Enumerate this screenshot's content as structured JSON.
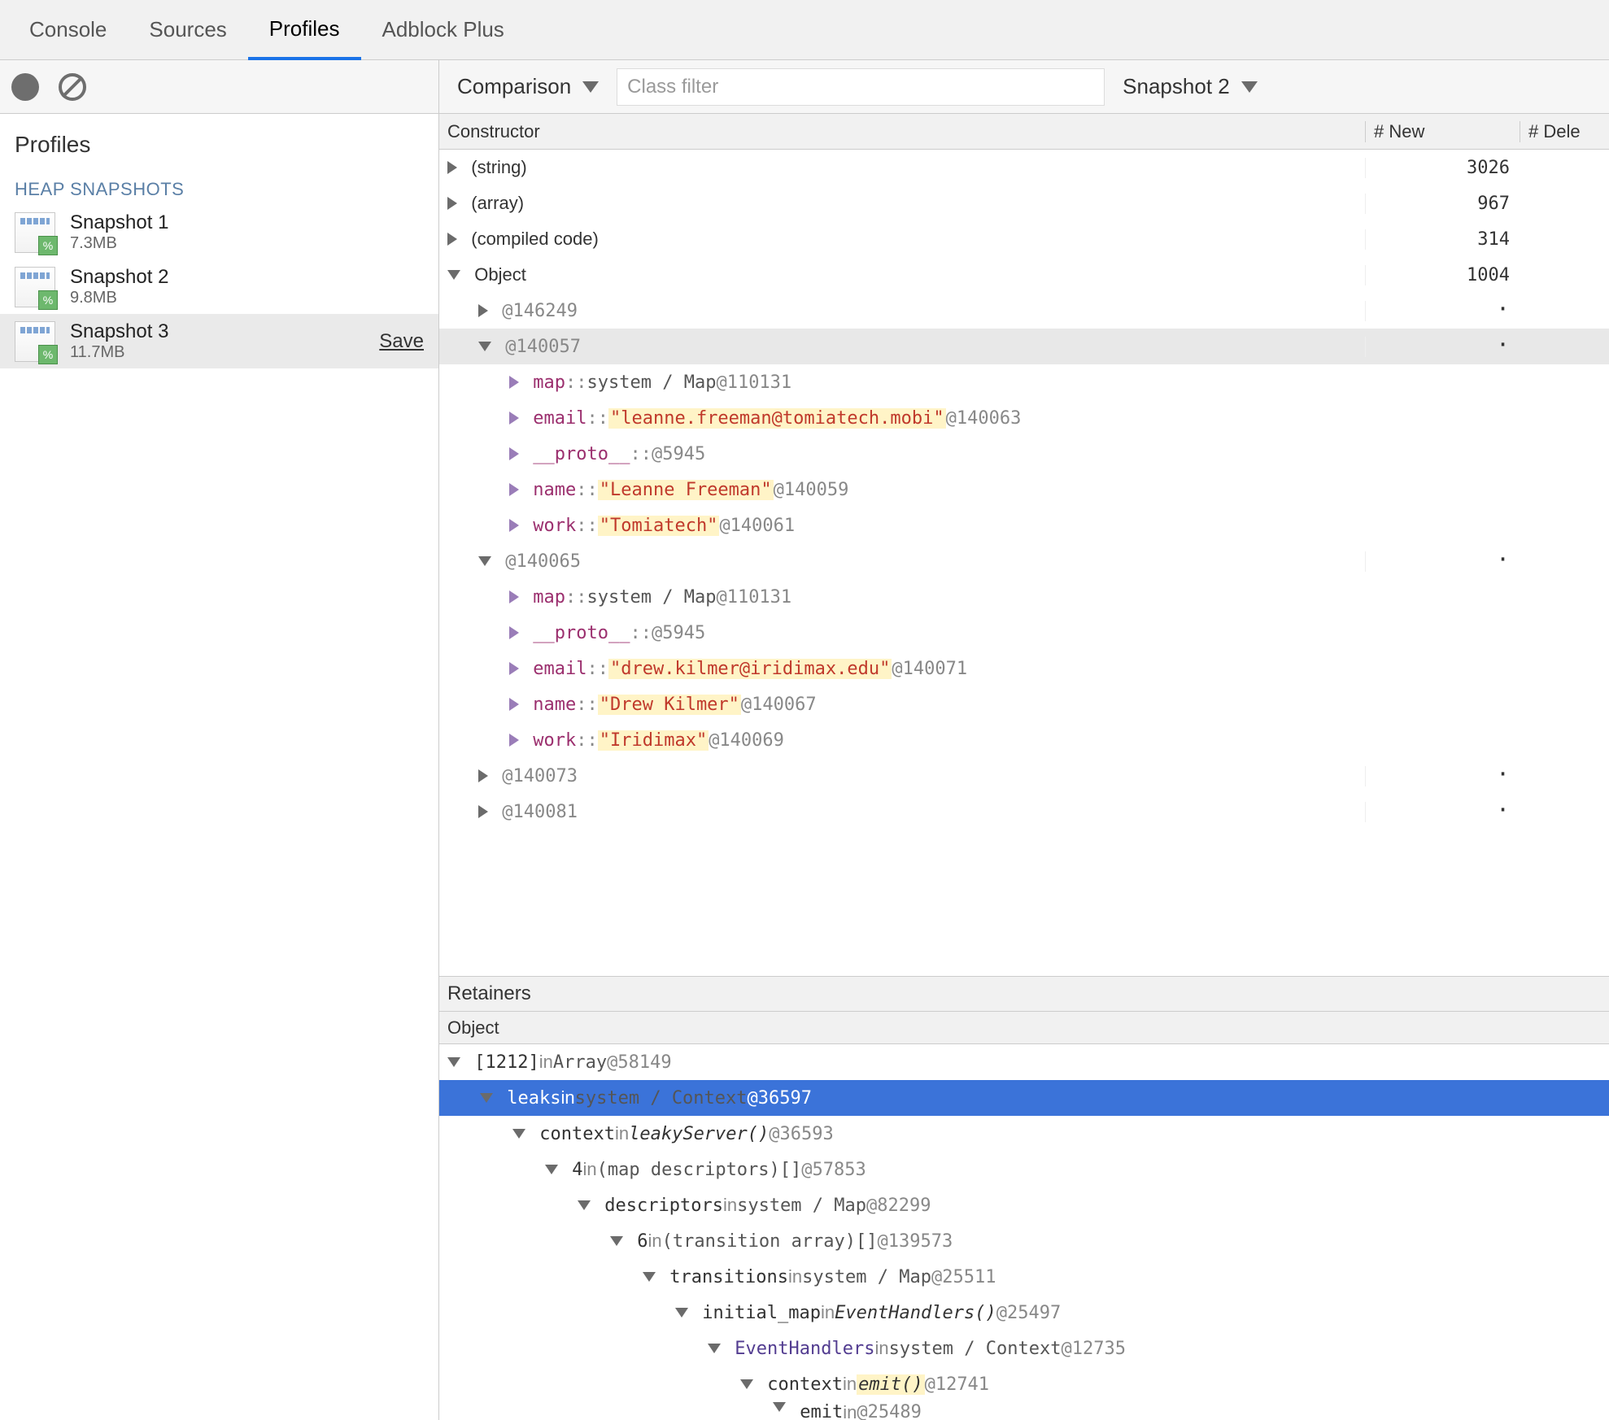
{
  "tabs": [
    "Console",
    "Sources",
    "Profiles",
    "Adblock Plus"
  ],
  "activeTab": "Profiles",
  "sidebar": {
    "title": "Profiles",
    "heading": "HEAP SNAPSHOTS",
    "snapshots": [
      {
        "name": "Snapshot 1",
        "size": "7.3MB"
      },
      {
        "name": "Snapshot 2",
        "size": "9.8MB"
      },
      {
        "name": "Snapshot 3",
        "size": "11.7MB",
        "selected": true,
        "save": "Save"
      }
    ]
  },
  "toolbar": {
    "view": "Comparison",
    "filterPlaceholder": "Class filter",
    "compareTo": "Snapshot 2"
  },
  "columns": {
    "constructor": "Constructor",
    "new": "# New",
    "dele": "# Dele"
  },
  "rows": [
    {
      "indent": 0,
      "arrow": "right",
      "label": "(string)",
      "new": "3026"
    },
    {
      "indent": 0,
      "arrow": "right",
      "label": "(array)",
      "new": "967"
    },
    {
      "indent": 0,
      "arrow": "right",
      "label": "(compiled code)",
      "new": "314"
    },
    {
      "indent": 0,
      "arrow": "down",
      "label": "Object",
      "new": "1004"
    },
    {
      "indent": 1,
      "arrow": "right",
      "addr": "@146249",
      "new": "·"
    },
    {
      "indent": 1,
      "arrow": "down",
      "addr": "@140057",
      "new": "·",
      "hl": true
    },
    {
      "indent": 2,
      "arrow": "right",
      "purple": true,
      "prop": "map",
      "sep": "::",
      "sys": "system / Map",
      "addr": "@110131"
    },
    {
      "indent": 2,
      "arrow": "right",
      "purple": true,
      "prop": "email",
      "sep": "::",
      "str": "\"leanne.freeman@tomiatech.mobi\"",
      "addr": "@140063"
    },
    {
      "indent": 2,
      "arrow": "right",
      "purple": true,
      "prop": "__proto__",
      "sep": "::",
      "addr": "@5945"
    },
    {
      "indent": 2,
      "arrow": "right",
      "purple": true,
      "prop": "name",
      "sep": "::",
      "str": "\"Leanne Freeman\"",
      "addr": "@140059"
    },
    {
      "indent": 2,
      "arrow": "right",
      "purple": true,
      "prop": "work",
      "sep": "::",
      "str": "\"Tomiatech\"",
      "addr": "@140061"
    },
    {
      "indent": 1,
      "arrow": "down",
      "addr": "@140065",
      "new": "·"
    },
    {
      "indent": 2,
      "arrow": "right",
      "purple": true,
      "prop": "map",
      "sep": "::",
      "sys": "system / Map",
      "addr": "@110131"
    },
    {
      "indent": 2,
      "arrow": "right",
      "purple": true,
      "prop": "__proto__",
      "sep": "::",
      "addr": "@5945"
    },
    {
      "indent": 2,
      "arrow": "right",
      "purple": true,
      "prop": "email",
      "sep": "::",
      "str": "\"drew.kilmer@iridimax.edu\"",
      "addr": "@140071"
    },
    {
      "indent": 2,
      "arrow": "right",
      "purple": true,
      "prop": "name",
      "sep": "::",
      "str": "\"Drew Kilmer\"",
      "addr": "@140067"
    },
    {
      "indent": 2,
      "arrow": "right",
      "purple": true,
      "prop": "work",
      "sep": "::",
      "str": "\"Iridimax\"",
      "addr": "@140069"
    },
    {
      "indent": 1,
      "arrow": "right",
      "addr": "@140073",
      "new": "·"
    },
    {
      "indent": 1,
      "arrow": "right",
      "addr": "@140081",
      "new": "·"
    }
  ],
  "retainers": {
    "title": "Retainers",
    "objectTitle": "Object",
    "rows": [
      {
        "indent": 0,
        "arrow": "down",
        "seg": [
          {
            "t": "plain",
            "v": "[1212] "
          },
          {
            "t": "kw",
            "v": "in "
          },
          {
            "t": "ctx",
            "v": "Array "
          },
          {
            "t": "addr",
            "v": "@58149"
          }
        ]
      },
      {
        "indent": 1,
        "arrow": "down",
        "sel": true,
        "seg": [
          {
            "t": "plain",
            "v": "leaks "
          },
          {
            "t": "kw",
            "v": "in "
          },
          {
            "t": "ctx",
            "v": "system / Context "
          },
          {
            "t": "addr",
            "v": "@36597"
          }
        ]
      },
      {
        "indent": 2,
        "arrow": "down",
        "seg": [
          {
            "t": "plain",
            "v": "context "
          },
          {
            "t": "kw",
            "v": "in "
          },
          {
            "t": "fn",
            "v": "leakyServer() "
          },
          {
            "t": "addr",
            "v": "@36593"
          }
        ]
      },
      {
        "indent": 3,
        "arrow": "down",
        "seg": [
          {
            "t": "plain",
            "v": "4 "
          },
          {
            "t": "kw",
            "v": "in "
          },
          {
            "t": "ctx",
            "v": "(map descriptors)[] "
          },
          {
            "t": "addr",
            "v": "@57853"
          }
        ]
      },
      {
        "indent": 4,
        "arrow": "down",
        "seg": [
          {
            "t": "plain",
            "v": "descriptors "
          },
          {
            "t": "kw",
            "v": "in "
          },
          {
            "t": "ctx",
            "v": "system / Map "
          },
          {
            "t": "addr",
            "v": "@82299"
          }
        ]
      },
      {
        "indent": 5,
        "arrow": "down",
        "seg": [
          {
            "t": "plain",
            "v": "6 "
          },
          {
            "t": "kw",
            "v": "in "
          },
          {
            "t": "ctx",
            "v": "(transition array)[] "
          },
          {
            "t": "addr",
            "v": "@139573"
          }
        ]
      },
      {
        "indent": 6,
        "arrow": "down",
        "seg": [
          {
            "t": "plain",
            "v": "transitions "
          },
          {
            "t": "kw",
            "v": "in "
          },
          {
            "t": "ctx",
            "v": "system / Map "
          },
          {
            "t": "addr",
            "v": "@25511"
          }
        ]
      },
      {
        "indent": 7,
        "arrow": "down",
        "seg": [
          {
            "t": "plain",
            "v": "initial_map "
          },
          {
            "t": "kw",
            "v": "in "
          },
          {
            "t": "fn",
            "v": "EventHandlers() "
          },
          {
            "t": "addr",
            "v": "@25497"
          }
        ]
      },
      {
        "indent": 8,
        "arrow": "down",
        "seg": [
          {
            "t": "ident",
            "v": "EventHandlers "
          },
          {
            "t": "kw",
            "v": "in "
          },
          {
            "t": "ctx",
            "v": "system / Context "
          },
          {
            "t": "addr",
            "v": "@12735"
          }
        ]
      },
      {
        "indent": 9,
        "arrow": "down",
        "seg": [
          {
            "t": "plain",
            "v": "context "
          },
          {
            "t": "kw",
            "v": "in "
          },
          {
            "t": "fnhl",
            "v": "emit() "
          },
          {
            "t": "addr",
            "v": "@12741"
          }
        ]
      },
      {
        "indent": 10,
        "arrow": "down",
        "partial": true,
        "seg": [
          {
            "t": "plain",
            "v": "emit "
          },
          {
            "t": "kw",
            "v": "in "
          },
          {
            "t": "addr",
            "v": "@25489"
          }
        ]
      }
    ]
  }
}
